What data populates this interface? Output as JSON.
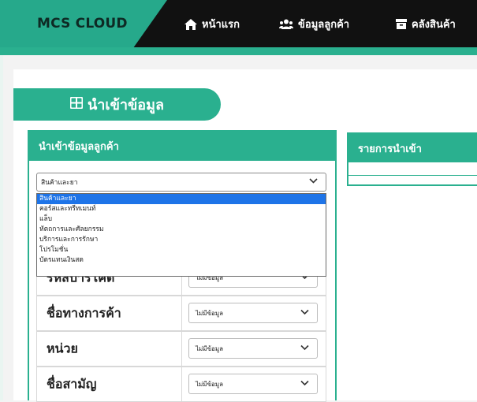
{
  "navbar": {
    "brand": "MCS CLOUD",
    "items": [
      {
        "label": "หน้าแรก",
        "icon": "home-icon"
      },
      {
        "label": "ข้อมูลลูกค้า",
        "icon": "users-icon"
      },
      {
        "label": "คลังสินค้า",
        "icon": "archive-icon"
      }
    ]
  },
  "import_tab": {
    "label": "นำเข้าข้อมูล",
    "icon": "table-icon"
  },
  "left_panel": {
    "title": "นำเข้าข้อมูลลูกค้า",
    "type_select": {
      "value": "สินค้าและยา"
    },
    "dropdown_options": [
      "สินค้าและยา",
      "คอร์สและทรีทเมนท์",
      "แล็บ",
      "หัตถการและศัลยกรรม",
      "บริการและการรักษา",
      "โปรโมชั่น",
      "บัตรแทนเงินสด"
    ],
    "mapping_rows": [
      {
        "label": "รหัสบาร์โค้ด",
        "value": "ไม่มีข้อมูล"
      },
      {
        "label": "ชื่อทางการค้า",
        "value": "ไม่มีข้อมูล"
      },
      {
        "label": "หน่วย",
        "value": "ไม่มีข้อมูล"
      },
      {
        "label": "ชื่อสามัญ",
        "value": "ไม่มีข้อมูล"
      }
    ]
  },
  "right_panel": {
    "title": "รายการนำเข้า"
  },
  "colors": {
    "accent": "#2ab08f",
    "navbar": "#111111",
    "selected": "#1e74e8"
  }
}
